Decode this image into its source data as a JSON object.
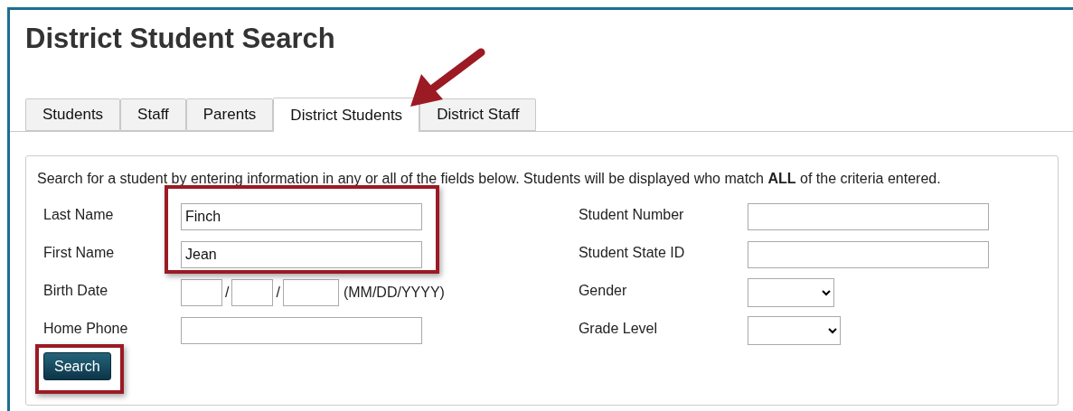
{
  "title": "District Student Search",
  "tabs": [
    {
      "label": "Students",
      "selected": false
    },
    {
      "label": "Staff",
      "selected": false
    },
    {
      "label": "Parents",
      "selected": false
    },
    {
      "label": "District Students",
      "selected": true
    },
    {
      "label": "District Staff",
      "selected": false
    }
  ],
  "instructions": "Search for a student by entering information in any or all of the fields below. Students will be displayed who match **ALL** of the criteria entered.",
  "left_fields": [
    {
      "label": "Last Name",
      "kind": "text",
      "value": "Finch",
      "highlighted": true
    },
    {
      "label": "First Name",
      "kind": "text",
      "value": "Jean",
      "highlighted": true
    },
    {
      "label": "Birth Date",
      "kind": "date",
      "slashes": [
        "/",
        "/"
      ],
      "hint": "(MM/DD/YYYY)",
      "highlighted": false
    },
    {
      "label": "Home Phone",
      "kind": "text",
      "highlighted": false
    }
  ],
  "right_fields": [
    {
      "label": "Student Number",
      "kind": "text",
      "highlighted": false
    },
    {
      "label": "Student State ID",
      "kind": "text",
      "highlighted": false
    },
    {
      "label": "Gender",
      "kind": "select",
      "highlighted": false
    },
    {
      "label": "Grade Level",
      "kind": "select",
      "highlighted": false
    }
  ],
  "search_button": {
    "label": "Search",
    "highlighted": true
  }
}
